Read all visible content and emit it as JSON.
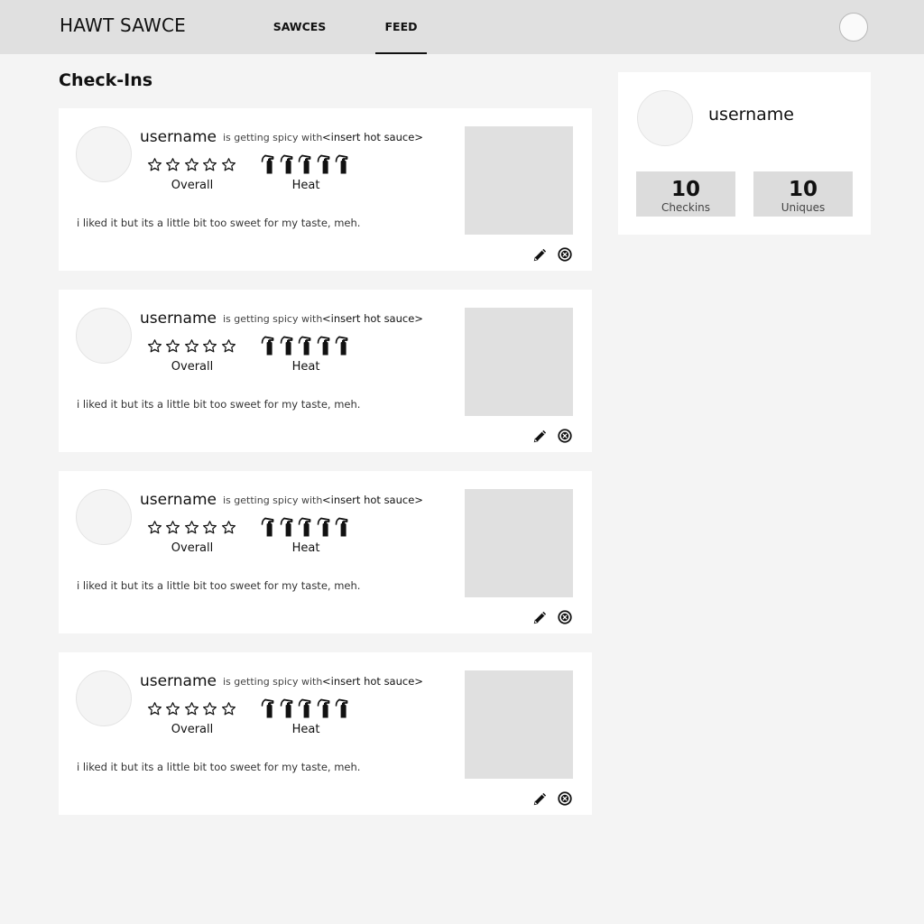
{
  "header": {
    "brand": "HAWT SAWCE",
    "tabs": [
      {
        "label": "SAWCES",
        "active": false
      },
      {
        "label": "FEED",
        "active": true
      }
    ]
  },
  "section": {
    "title": "Check-Ins"
  },
  "icons": {
    "star": "star-outline-icon",
    "heat": "fire-extinguisher-icon",
    "edit": "pencil-icon",
    "delete": "circle-x-icon"
  },
  "checkins": [
    {
      "username": "username",
      "action": "is getting spicy with",
      "sauce": "<insert hot sauce>",
      "overall_label": "Overall",
      "heat_label": "Heat",
      "overall_rating": 0,
      "heat_rating": 5,
      "comment": "i liked it but its a little bit too sweet for my taste, meh."
    },
    {
      "username": "username",
      "action": "is getting spicy with",
      "sauce": "<insert hot sauce>",
      "overall_label": "Overall",
      "heat_label": "Heat",
      "overall_rating": 0,
      "heat_rating": 5,
      "comment": "i liked it but its a little bit too sweet for my taste, meh."
    },
    {
      "username": "username",
      "action": "is getting spicy with",
      "sauce": "<insert hot sauce>",
      "overall_label": "Overall",
      "heat_label": "Heat",
      "overall_rating": 0,
      "heat_rating": 5,
      "comment": "i liked it but its a little bit too sweet for my taste, meh."
    },
    {
      "username": "username",
      "action": "is getting spicy with",
      "sauce": "<insert hot sauce>",
      "overall_label": "Overall",
      "heat_label": "Heat",
      "overall_rating": 0,
      "heat_rating": 5,
      "comment": "i liked it but its a little bit too sweet for my taste, meh."
    }
  ],
  "profile": {
    "username": "username",
    "stats": [
      {
        "value": "10",
        "label": "Checkins"
      },
      {
        "value": "10",
        "label": "Uniques"
      }
    ]
  },
  "colors": {
    "header_bg": "#e0e0e0",
    "page_bg": "#f4f4f4",
    "card_bg": "#ffffff",
    "placeholder": "#e0e0e0",
    "stat_bg": "#dcdcdc"
  }
}
